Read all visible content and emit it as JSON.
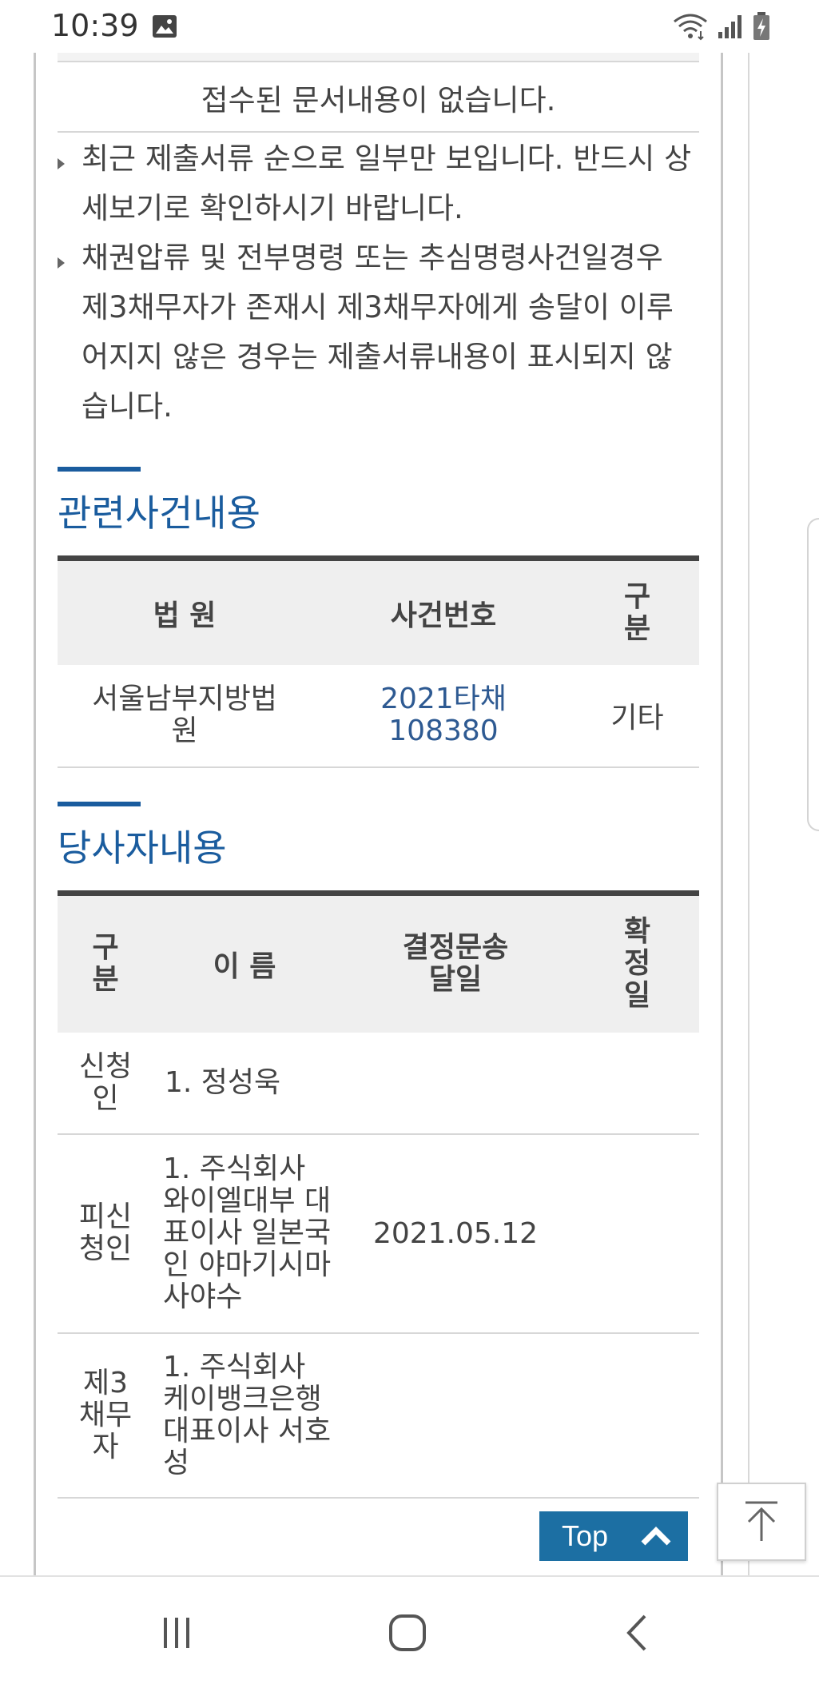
{
  "status_bar": {
    "time": "10:39",
    "icons": [
      "image-icon",
      "wifi-icon",
      "signal-icon",
      "battery-charging-icon"
    ]
  },
  "documents": {
    "empty_message": "접수된 문서내용이 없습니다.",
    "notices": [
      "최근 제출서류 순으로 일부만 보입니다. 반드시 상세보기로 확인하시기 바랍니다.",
      "채권압류 및 전부명령 또는 추심명령사건일경우 제3채무자가 존재시 제3채무자에게 송달이 이루어지지 않은 경우는 제출서류내용이 표시되지 않습니다."
    ]
  },
  "related_cases": {
    "title": "관련사건내용",
    "headers": [
      "법 원",
      "사건번호",
      "구분"
    ],
    "rows": [
      {
        "court": "서울남부지방법원",
        "case_no": "2021타채108380",
        "type": "기타"
      }
    ]
  },
  "parties": {
    "title": "당사자내용",
    "headers": [
      "구분",
      "이 름",
      "결정문송달일",
      "확정일"
    ],
    "rows": [
      {
        "role": "신청인",
        "name": "1. 정성욱",
        "served": "",
        "confirmed": ""
      },
      {
        "role": "피신청인",
        "name": "1. 주식회사 와이엘대부 대표이사 일본국인 야마기시마사야수",
        "served": "2021.05.12",
        "confirmed": ""
      },
      {
        "role": "제3채무자",
        "name": "1. 주식회사 케이뱅크은행 대표이사 서호성",
        "served": "",
        "confirmed": ""
      }
    ]
  },
  "top_button": {
    "label": "Top"
  },
  "colors": {
    "accent": "#1a5c9e",
    "link": "#2e5a92",
    "top_button": "#1c6fa3",
    "header_bg": "#efefef"
  },
  "nav_bar": {
    "items": [
      "recent-apps-icon",
      "home-icon",
      "back-icon"
    ]
  }
}
